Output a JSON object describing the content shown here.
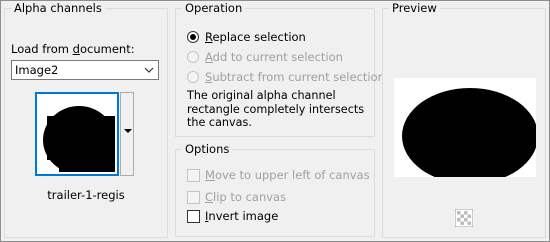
{
  "alpha_channels": {
    "title": "Alpha channels",
    "load_label_pre": "Load from ",
    "load_label_u": "d",
    "load_label_post": "ocument:",
    "document_value": "Image2",
    "channel_name": "trailer-1-regis"
  },
  "operation": {
    "title": "Operation",
    "options": [
      {
        "u": "R",
        "rest": "eplace selection",
        "checked": true,
        "enabled": true
      },
      {
        "u": "A",
        "rest": "dd to current selection",
        "checked": false,
        "enabled": false
      },
      {
        "u": "S",
        "rest": "ubtract from current selection",
        "checked": false,
        "enabled": false
      }
    ],
    "description": "The original alpha channel rectangle completely intersects the canvas."
  },
  "options": {
    "title": "Options",
    "move": {
      "u": "M",
      "rest": "ove to upper left of canvas",
      "checked": false,
      "enabled": false
    },
    "clip": {
      "u": "C",
      "rest": "lip to canvas",
      "checked": false,
      "enabled": false
    },
    "invert": {
      "u": "I",
      "rest": "nvert image",
      "checked": false,
      "enabled": true
    }
  },
  "preview": {
    "title": "Preview"
  },
  "colors": {
    "accent": "#0078d7",
    "disabled_text": "#a0a0a0",
    "background": "#f0f0f0"
  },
  "icons": {
    "dropdown": "chevron-down-icon",
    "transparency": "checkerboard-icon"
  }
}
